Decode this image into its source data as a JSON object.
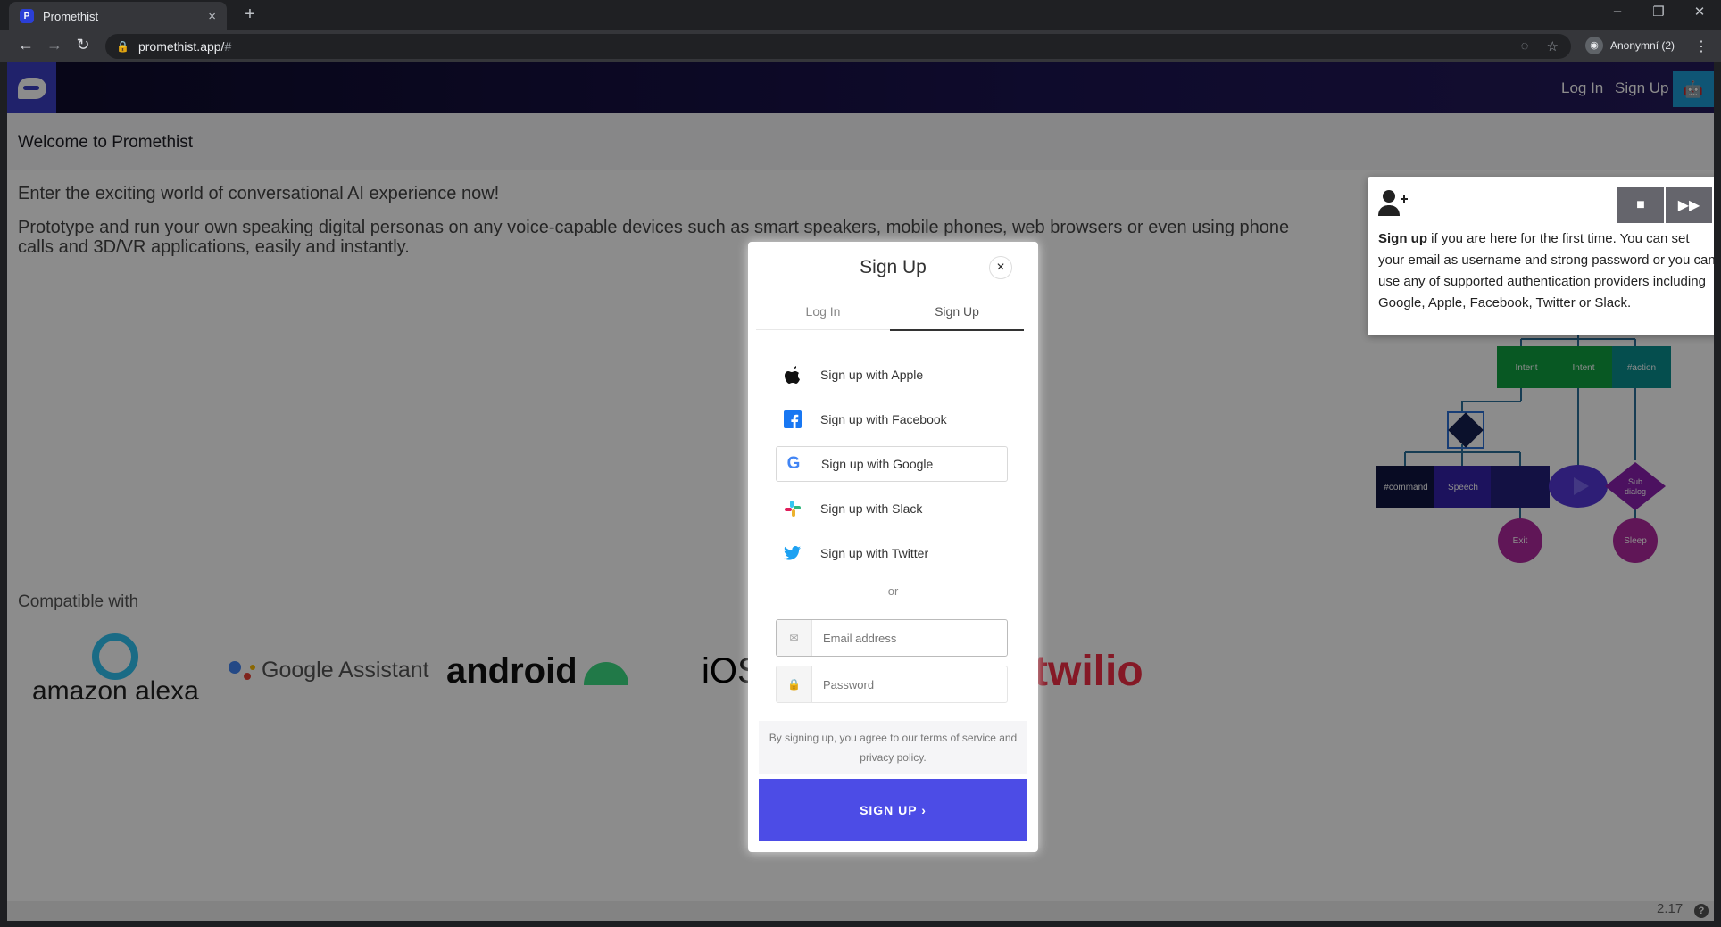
{
  "browser": {
    "tab_title": "Promethist",
    "new_tab_glyph": "+",
    "close_tab_glyph": "×",
    "url_host": "promethist.app/",
    "url_hash": "#",
    "profile_label": "Anonymní (2)"
  },
  "app": {
    "nav_login": "Log In",
    "nav_signup": "Sign Up",
    "welcome_title": "Welcome to Promethist",
    "intro_line1": "Enter the exciting world of conversational AI experience now!",
    "intro_line2": "Prototype and run your own speaking digital personas on any voice-capable devices such as smart speakers, mobile phones, web browsers or even using phone calls and 3D/VR applications, easily and instantly.",
    "compatible_label": "Compatible with",
    "brands": {
      "alexa": "amazon alexa",
      "google": "Google Assistant",
      "android": "android",
      "ios": "iOS",
      "twilio": "twilio"
    },
    "flow_labels": {
      "intent1": "Intent",
      "intent2": "Intent",
      "action": "#action",
      "command": "#command",
      "speech": "Speech",
      "subdialog_line1": "Sub",
      "subdialog_line2": "dialog",
      "exit": "Exit",
      "sleep": "Sleep"
    },
    "version": "2.17",
    "help_glyph": "?"
  },
  "modal": {
    "title": "Sign Up",
    "close_glyph": "×",
    "tab_login": "Log In",
    "tab_signup": "Sign Up",
    "sso": [
      {
        "label": "Sign up with Apple",
        "icon": "apple-icon"
      },
      {
        "label": "Sign up with Facebook",
        "icon": "facebook-icon"
      },
      {
        "label": "Sign up with Google",
        "icon": "google-icon"
      },
      {
        "label": "Sign up with Slack",
        "icon": "slack-icon"
      },
      {
        "label": "Sign up with Twitter",
        "icon": "twitter-icon"
      }
    ],
    "or": "or",
    "email_placeholder": "Email address",
    "password_placeholder": "Password",
    "terms": "By signing up, you agree to our terms of service and privacy policy.",
    "submit": "SIGN UP ›"
  },
  "tooltip": {
    "bold": "Sign up",
    "text": " if you are here for the first time. You can set your email as username and strong password or you can use any of supported authentication providers including Google, Apple, Facebook, Twitter or Slack."
  },
  "colors": {
    "accent": "#4c4ce6",
    "bot_button": "#1c9bd6",
    "twilio": "#f22f46"
  }
}
